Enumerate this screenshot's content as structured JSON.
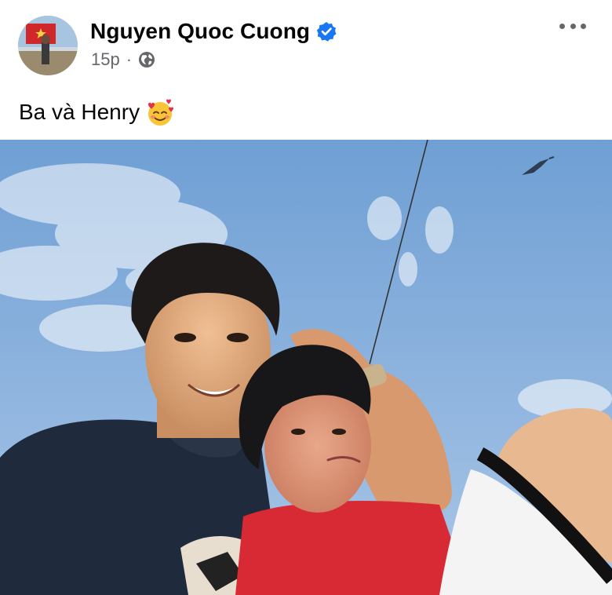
{
  "post": {
    "author": "Nguyen Quoc Cuong",
    "verified": true,
    "time": "15p",
    "separator": "·",
    "audience_icon": "globe-icon",
    "more_icon": "more-options-icon",
    "caption": "Ba và Henry",
    "caption_emoji": "smiling-face-with-hearts-emoji"
  },
  "photo": {
    "description_icon": "post-photo"
  },
  "colors": {
    "verified": "#1877f2",
    "meta_text": "#65676b",
    "name_text": "#050505",
    "sky_top": "#6f9fd4",
    "sky_bottom": "#a9c6e7"
  }
}
